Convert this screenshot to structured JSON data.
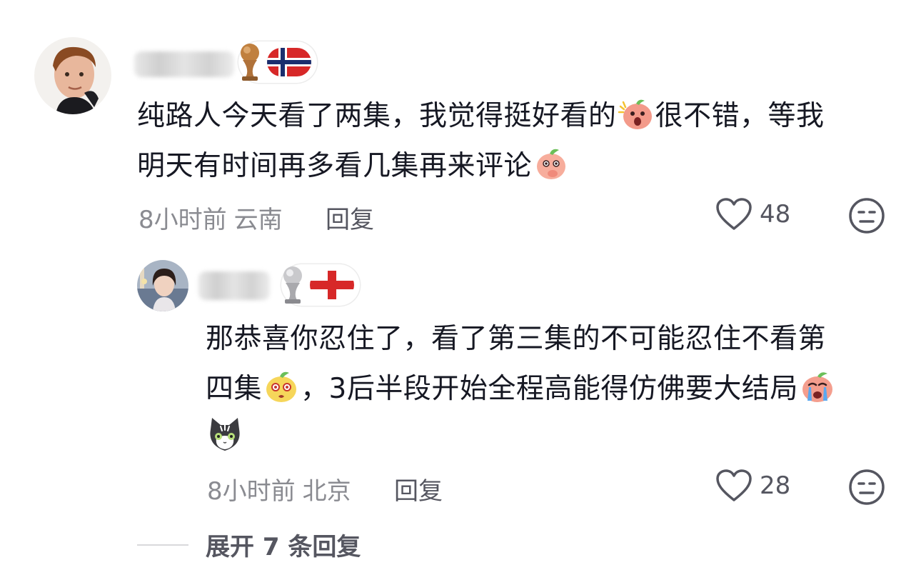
{
  "comment": {
    "text_line1": "纯路人今天看了两集，我觉得挺好看的",
    "text_line1b": "很不错，等我",
    "text_line2": "明天有时间再多看几集再来评论",
    "time": "8小时前",
    "location": "云南",
    "reply_label": "回复",
    "likes": "48",
    "flag_icon": "norway-flag-icon",
    "trophy_icon": "bronze-trophy-icon"
  },
  "reply": {
    "text_line1": "那恭喜你忍住了，看了第三集的不可能忍住不看第",
    "text_line2a": "四集",
    "text_line2b": "，3后半段开始全程高能得仿佛要大结局",
    "time": "8小时前",
    "location": "北京",
    "reply_label": "回复",
    "likes": "28",
    "flag_icon": "england-flag-icon",
    "trophy_icon": "silver-trophy-icon"
  },
  "expand_label": "展开 7 条回复",
  "colors": {
    "text": "#161823",
    "meta": "#8a8b91",
    "action": "#555660",
    "flag_red": "#d72828",
    "flag_blue": "#1b2e6e"
  }
}
